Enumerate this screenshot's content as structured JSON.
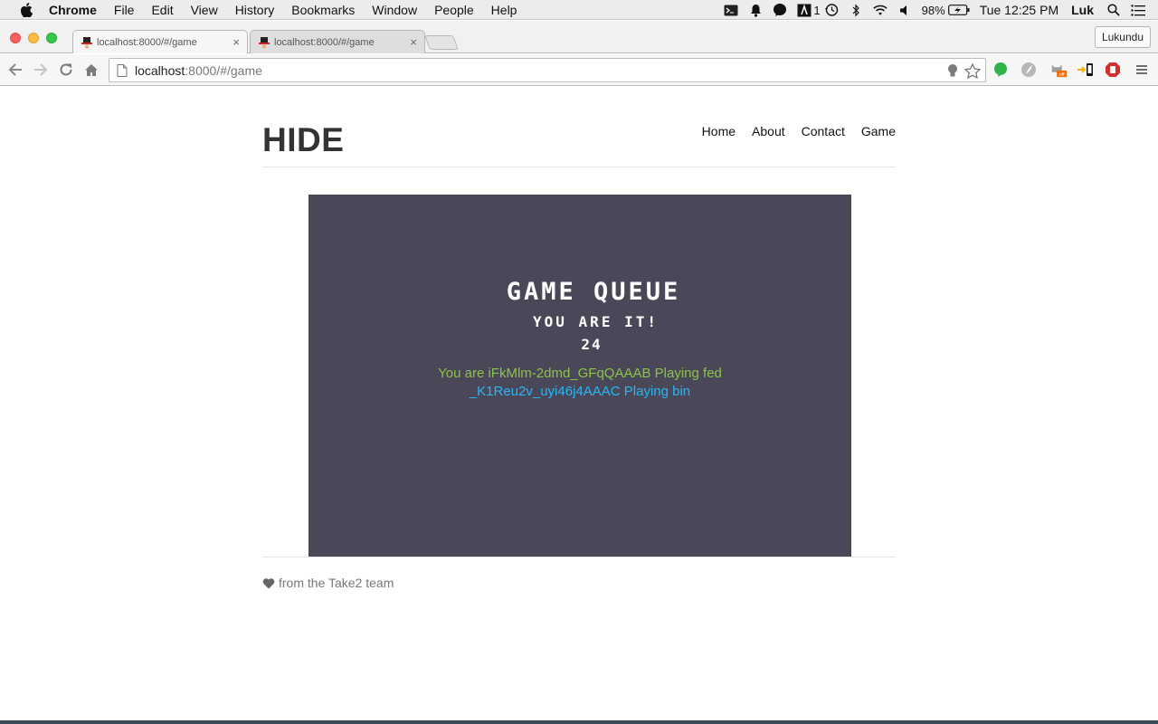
{
  "menubar": {
    "app_name": "Chrome",
    "items": [
      "File",
      "Edit",
      "View",
      "History",
      "Bookmarks",
      "Window",
      "People",
      "Help"
    ],
    "status": {
      "notification_count": "1",
      "battery": "98%",
      "clock": "Tue 12:25 PM",
      "user": "Luk"
    }
  },
  "browser": {
    "tabs": [
      {
        "title": "localhost:8000/#/game",
        "close": "×"
      },
      {
        "title": "localhost:8000/#/game",
        "close": "×"
      }
    ],
    "profile_name": "Lukundu",
    "url_host": "localhost",
    "url_rest": ":8000/#/game",
    "accent": "#1a73e8"
  },
  "site": {
    "brand": "HIDE",
    "nav": [
      "Home",
      "About",
      "Contact",
      "Game"
    ]
  },
  "game": {
    "background": "#4a4858",
    "title": "GAME QUEUE",
    "status": "YOU ARE IT!",
    "countdown": "24",
    "player_line": "You are iFkMlm-2dmd_GFqQAAAB Playing fed",
    "opponent_line": "_K1Reu2v_uyi46j4AAAC Playing bin",
    "player_color": "#8bc34a",
    "opponent_color": "#29b6f6"
  },
  "footer": {
    "text": "from the Take2 team",
    "icon": "heart-icon"
  }
}
